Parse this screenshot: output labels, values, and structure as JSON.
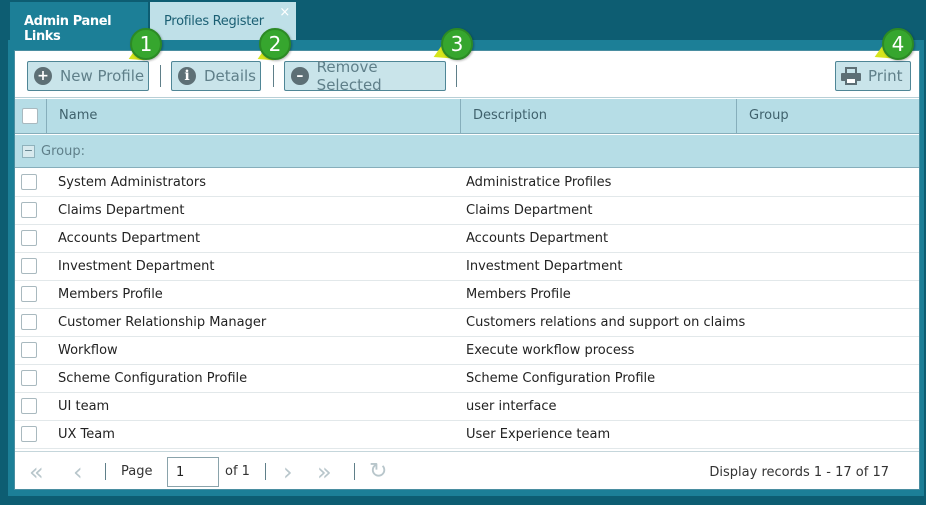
{
  "tabs": [
    {
      "label": "Admin Panel Links"
    },
    {
      "label": "Profiles Register",
      "close": "×"
    }
  ],
  "toolbar": {
    "new_profile": "New Profile",
    "details": "Details",
    "remove_selected": "Remove Selected",
    "print": "Print"
  },
  "callouts": [
    "1",
    "2",
    "3",
    "4"
  ],
  "table": {
    "columns": [
      "Name",
      "Description",
      "Group"
    ],
    "group_label": "Group:",
    "rows": [
      {
        "name": "System Administrators",
        "description": "Administratice Profiles"
      },
      {
        "name": "Claims Department",
        "description": "Claims Department"
      },
      {
        "name": "Accounts Department",
        "description": "Accounts Department"
      },
      {
        "name": "Investment Department",
        "description": "Investment Department"
      },
      {
        "name": "Members Profile",
        "description": "Members Profile"
      },
      {
        "name": "Customer Relationship Manager",
        "description": "Customers relations and support on claims"
      },
      {
        "name": "Workflow",
        "description": "Execute workflow process"
      },
      {
        "name": "Scheme Configuration Profile",
        "description": "Scheme Configuration Profile"
      },
      {
        "name": "UI team",
        "description": "user interface"
      },
      {
        "name": "UX Team",
        "description": "User Experience team"
      }
    ]
  },
  "pager": {
    "page_label": "Page",
    "page_value": "1",
    "of_label": "of 1",
    "info": "Display records 1 - 17 of 17"
  },
  "icons": {
    "first": "first-page-icon",
    "prev": "prev-page-icon",
    "next": "next-page-icon",
    "last": "last-page-icon",
    "refresh": "refresh-icon",
    "print": "printer-icon"
  },
  "colors": {
    "accent": "#1c7f97",
    "background": "#0d5d72",
    "header": "#b6dde6",
    "button": "#c9e4ea",
    "callout": "#36a62e",
    "callout_tail": "#d6e51c"
  }
}
